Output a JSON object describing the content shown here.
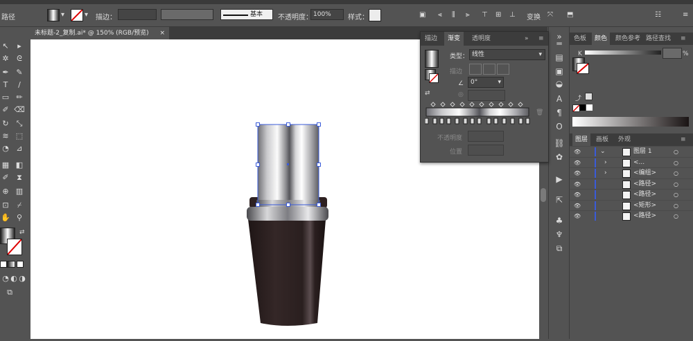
{
  "control_bar": {
    "selection_label": "路径",
    "stroke_label": "描边：",
    "stroke_profile": "基本",
    "opacity_label": "不透明度：",
    "opacity_value": "100%",
    "style_label": "样式：",
    "transform_label": "变换"
  },
  "document": {
    "tab_title": "未标题-2_复制.ai* @ 150% (RGB/预览)",
    "close_glyph": "×"
  },
  "gradient_panel": {
    "tabs": [
      "描边",
      "渐变",
      "透明度"
    ],
    "active_tab": "渐变",
    "type_label": "类型：",
    "type_value": "线性",
    "stroke_label": "描边",
    "angle_value": "0°",
    "opacity_label": "不透明度",
    "position_label": "位置"
  },
  "right_panel": {
    "top_tabs": [
      "色板",
      "颜色",
      "颜色参考",
      "路径查找"
    ],
    "active_top_tab": "颜色",
    "k_label": "K",
    "percent_label": "%",
    "layer_tabs": [
      "图层",
      "画板",
      "外观"
    ],
    "active_layer_tab": "图层",
    "layers": [
      {
        "name": "图层 1",
        "kind": "layer"
      },
      {
        "name": "<...",
        "kind": "sub"
      },
      {
        "name": "<编组>",
        "kind": "sub"
      },
      {
        "name": "<路径>",
        "kind": "item"
      },
      {
        "name": "<路径>",
        "kind": "item"
      },
      {
        "name": "<矩形>",
        "kind": "item"
      },
      {
        "name": "<路径>",
        "kind": "item"
      }
    ]
  },
  "colors": {
    "ui_bg": "#535353",
    "ui_dark": "#3c3c3c",
    "selection": "#3a5bd9",
    "bottle_dark": "#2e2121"
  }
}
